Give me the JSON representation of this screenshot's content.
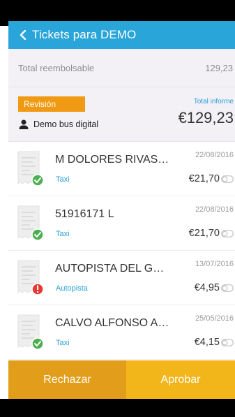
{
  "header": {
    "title": "Tickets para DEMO",
    "back_icon": "chevron-left-icon"
  },
  "summary": {
    "label": "Total reembolsable",
    "value": "129,23"
  },
  "report": {
    "status": "Revisión",
    "status_color": "#ef9a12",
    "owner": "Demo bus digital",
    "total_label": "Total informe",
    "total_value": "€129,23"
  },
  "tickets": [
    {
      "name": "M DOLORES RIVAS ...",
      "date": "22/08/2016",
      "category": "Taxi",
      "amount": "€21,70",
      "status": "ok"
    },
    {
      "name": "51916171 L",
      "date": "22/08/2016",
      "category": "Taxi",
      "amount": "€21,70",
      "status": "ok"
    },
    {
      "name": "AUTOPISTA DEL GU...",
      "date": "13/07/2016",
      "category": "Autopista",
      "amount": "€4,95",
      "status": "error"
    },
    {
      "name": "CALVO ALFONSO AR...",
      "date": "25/05/2016",
      "category": "Taxi",
      "amount": "€4,15",
      "status": "ok"
    }
  ],
  "actions": {
    "reject": "Rechazar",
    "approve": "Aprobar"
  },
  "colors": {
    "primary": "#2aa5d9",
    "accent": "#2a9fd6",
    "success": "#4caf50",
    "error": "#e53935",
    "reject": "#e29e1a",
    "approve": "#f2b51a"
  }
}
